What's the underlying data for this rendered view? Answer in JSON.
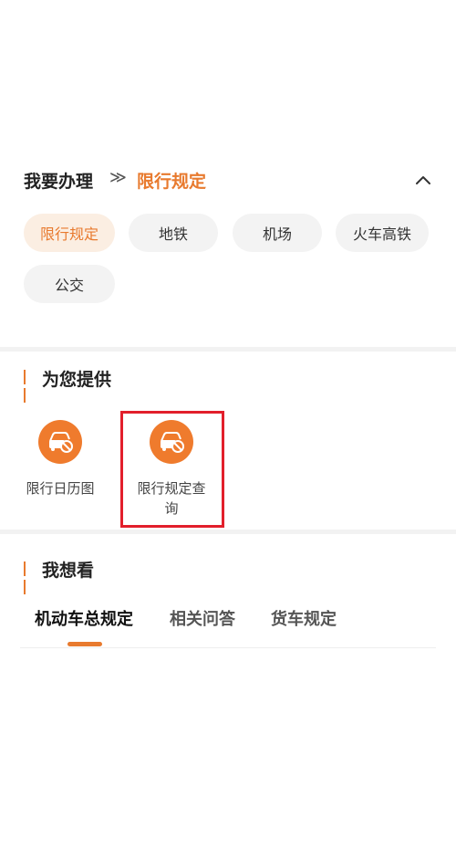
{
  "header": {
    "label": "我要办理",
    "separator": "≫",
    "current": "限行规定"
  },
  "chips": [
    {
      "label": "限行规定",
      "active": true
    },
    {
      "label": "地铁",
      "active": false
    },
    {
      "label": "机场",
      "active": false
    },
    {
      "label": "火车高铁",
      "active": false
    },
    {
      "label": "公交",
      "active": false
    }
  ],
  "provide_section": {
    "title": "为您提供",
    "services": [
      {
        "label": "限行日历图",
        "icon": "car-restriction-icon"
      },
      {
        "label_line1": "限行规定查",
        "label_line2": "询",
        "icon": "car-restriction-icon"
      }
    ]
  },
  "want_section": {
    "title": "我想看",
    "tabs": [
      {
        "label": "机动车总规定",
        "active": true
      },
      {
        "label": "相关问答",
        "active": false
      },
      {
        "label": "货车规定",
        "active": false
      }
    ]
  },
  "colors": {
    "accent": "#e87a2e",
    "icon_bg": "#ef7b2d",
    "highlight": "#e21f2b",
    "chip_bg": "#f3f3f3",
    "chip_active_bg": "#fbeee2"
  }
}
